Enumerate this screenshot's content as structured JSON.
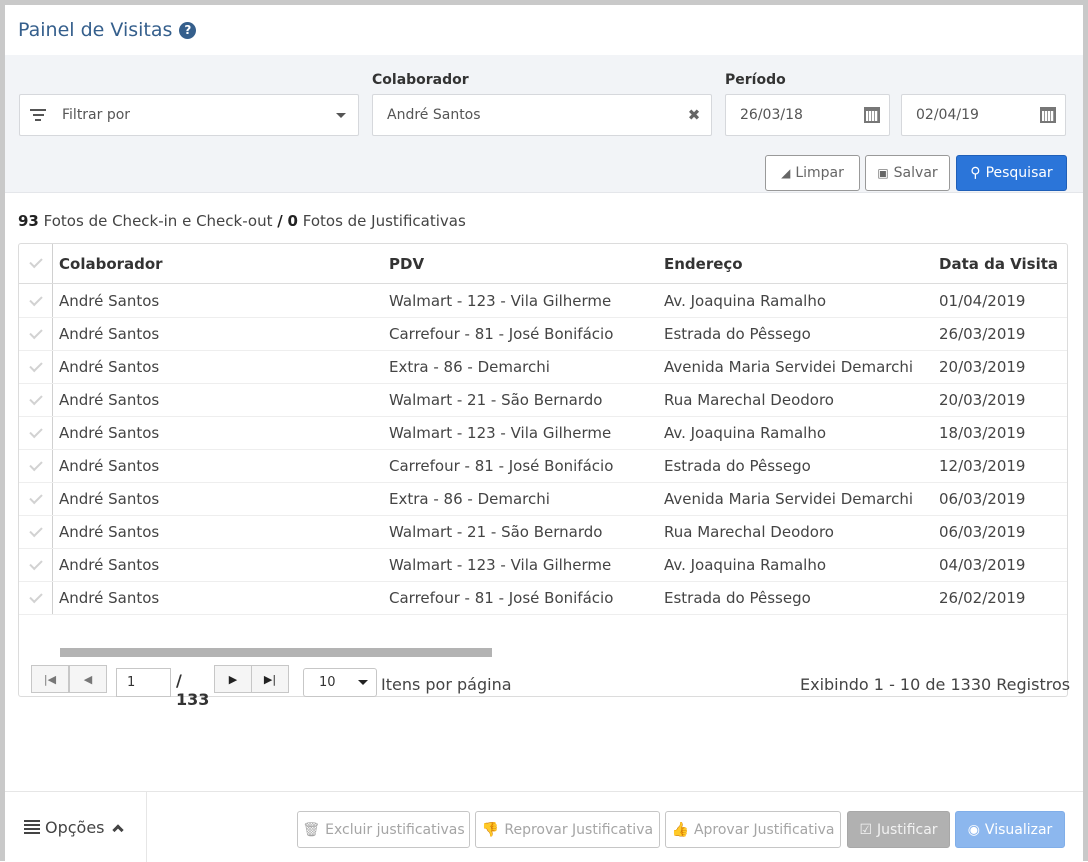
{
  "header": {
    "title": "Painel de Visitas",
    "help_icon": "question-circle-icon"
  },
  "filters": {
    "filter_by_placeholder": "Filtrar por",
    "colaborador_label": "Colaborador",
    "colaborador_value": "André Santos",
    "periodo_label": "Período",
    "date_start": "26/03/18",
    "date_end": "02/04/19"
  },
  "actions": {
    "clear_label": "Limpar",
    "save_label": "Salvar",
    "search_label": "Pesquisar"
  },
  "summary": {
    "checkin_count": "93",
    "checkin_text": "Fotos de Check-in e Check-out",
    "separator": "/",
    "justif_count": "0",
    "justif_text": "Fotos de Justificativas"
  },
  "table": {
    "columns": [
      "Colaborador",
      "PDV",
      "Endereço",
      "Data da Visita"
    ],
    "rows": [
      [
        "André Santos",
        "Walmart - 123 - Vila Gilherme",
        "Av. Joaquina Ramalho",
        "01/04/2019"
      ],
      [
        "André Santos",
        "Carrefour - 81 - José Bonifácio",
        "Estrada do Pêssego",
        "26/03/2019"
      ],
      [
        "André Santos",
        "Extra - 86 - Demarchi",
        "Avenida Maria Servidei Demarchi",
        "20/03/2019"
      ],
      [
        "André Santos",
        "Walmart - 21 - São Bernardo",
        "Rua Marechal Deodoro",
        "20/03/2019"
      ],
      [
        "André Santos",
        "Walmart - 123 - Vila Gilherme",
        "Av. Joaquina Ramalho",
        "18/03/2019"
      ],
      [
        "André Santos",
        "Carrefour - 81 - José Bonifácio",
        "Estrada do Pêssego",
        "12/03/2019"
      ],
      [
        "André Santos",
        "Extra - 86 - Demarchi",
        "Avenida Maria Servidei Demarchi",
        "06/03/2019"
      ],
      [
        "André Santos",
        "Walmart - 21 - São Bernardo",
        "Rua Marechal Deodoro",
        "06/03/2019"
      ],
      [
        "André Santos",
        "Walmart - 123 - Vila Gilherme",
        "Av. Joaquina Ramalho",
        "04/03/2019"
      ],
      [
        "André Santos",
        "Carrefour - 81 - José Bonifácio",
        "Estrada do Pêssego",
        "26/02/2019"
      ]
    ]
  },
  "pagination": {
    "current_page": "1",
    "total_pages": "/ 133",
    "per_page": "10",
    "per_page_label": "Itens por página",
    "records_text": "Exibindo 1 - 10 de 1330 Registros"
  },
  "footer": {
    "options_label": "Opções",
    "delete_label": "Excluir justificativas",
    "reject_label": "Reprovar Justificativa",
    "approve_label": "Aprovar Justificativa",
    "justify_label": "Justificar",
    "view_label": "Visualizar"
  },
  "colors": {
    "title": "#355f8c",
    "primary": "#2b75d9",
    "view_button": "#8cb7ee",
    "justify_button": "#b1b1b1"
  }
}
